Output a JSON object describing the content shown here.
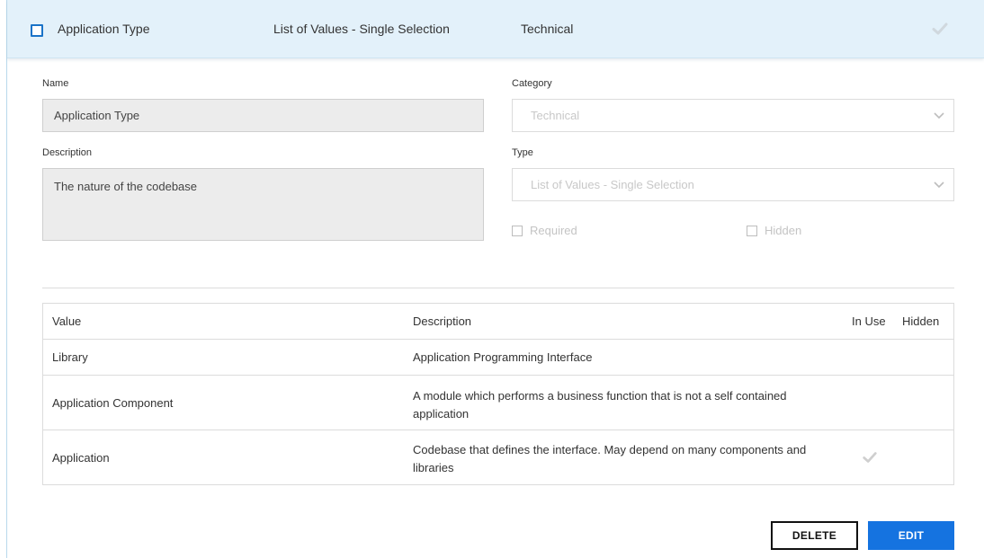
{
  "header": {
    "name": "Application Type",
    "type": "List of Values - Single Selection",
    "category": "Technical",
    "check_icon": "checkmark-icon"
  },
  "form": {
    "name_label": "Name",
    "name_value": "Application Type",
    "description_label": "Description",
    "description_value": "The nature of the codebase",
    "category_label": "Category",
    "category_value": "Technical",
    "type_label": "Type",
    "type_value": "List of Values - Single Selection",
    "required_label": "Required",
    "hidden_label": "Hidden"
  },
  "table": {
    "columns": [
      "Value",
      "Description",
      "In Use",
      "Hidden"
    ],
    "rows": [
      {
        "value": "Library",
        "description": "Application Programming Interface",
        "in_use": false
      },
      {
        "value": "Application Component",
        "description": "A module which performs a business function that is not a self contained application",
        "in_use": false
      },
      {
        "value": "Application",
        "description": "Codebase that defines the interface. May depend on many components and libraries",
        "in_use": true
      }
    ]
  },
  "actions": {
    "delete_label": "DELETE",
    "edit_label": "EDIT"
  },
  "colors": {
    "header_bg": "#e3f1fa",
    "accent": "#1573e0"
  }
}
